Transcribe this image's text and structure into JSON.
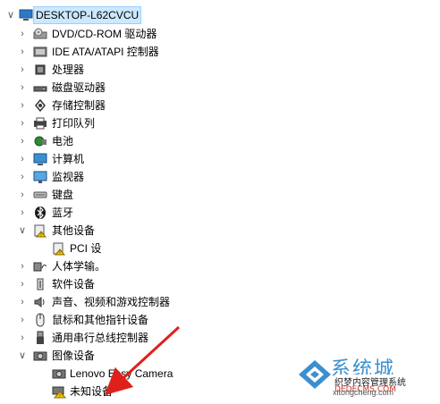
{
  "tree": {
    "root": {
      "label": "DESKTOP-L62CVCU",
      "icon": "computer-icon"
    },
    "items": [
      {
        "label": "DVD/CD-ROM 驱动器",
        "icon": "dvd-drive-icon",
        "expanded": false
      },
      {
        "label": "IDE ATA/ATAPI 控制器",
        "icon": "ide-controller-icon",
        "expanded": false
      },
      {
        "label": "处理器",
        "icon": "processor-icon",
        "expanded": false
      },
      {
        "label": "磁盘驱动器",
        "icon": "disk-drive-icon",
        "expanded": false
      },
      {
        "label": "存储控制器",
        "icon": "storage-controller-icon",
        "expanded": false
      },
      {
        "label": "打印队列",
        "icon": "printer-icon",
        "expanded": false
      },
      {
        "label": "电池",
        "icon": "battery-icon",
        "expanded": false
      },
      {
        "label": "计算机",
        "icon": "computer-monitor-icon",
        "expanded": false
      },
      {
        "label": "监视器",
        "icon": "monitor-icon",
        "expanded": false
      },
      {
        "label": "键盘",
        "icon": "keyboard-icon",
        "expanded": false
      },
      {
        "label": "蓝牙",
        "icon": "bluetooth-icon",
        "expanded": false
      },
      {
        "label": "其他设备",
        "icon": "other-devices-icon",
        "expanded": true,
        "children": [
          {
            "label": "PCI 设",
            "icon": "warning-device-icon"
          }
        ]
      },
      {
        "label": "人体学输。",
        "icon": "hid-icon",
        "expanded": false
      },
      {
        "label": "软件设备",
        "icon": "software-device-icon",
        "expanded": false
      },
      {
        "label": "声音、视频和游戏控制器",
        "icon": "speaker-icon",
        "expanded": false
      },
      {
        "label": "鼠标和其他指针设备",
        "icon": "mouse-icon",
        "expanded": false
      },
      {
        "label": "通用串行总线控制器",
        "icon": "usb-icon",
        "expanded": false
      },
      {
        "label": "图像设备",
        "icon": "imaging-device-icon",
        "expanded": true,
        "children": [
          {
            "label": "Lenovo Easy Camera",
            "icon": "camera-icon"
          },
          {
            "label": "未知设备",
            "icon": "unknown-device-warning-icon"
          }
        ]
      }
    ]
  },
  "watermark": {
    "brand": "系统城",
    "subtitle": "织梦内容管理系统",
    "domain": "DEDECMS.COM",
    "url": "xitongcheng.com"
  },
  "colors": {
    "selection_bg": "#cce8ff",
    "arrow": "#e0201a",
    "watermark_blue": "#3a8fd0"
  }
}
